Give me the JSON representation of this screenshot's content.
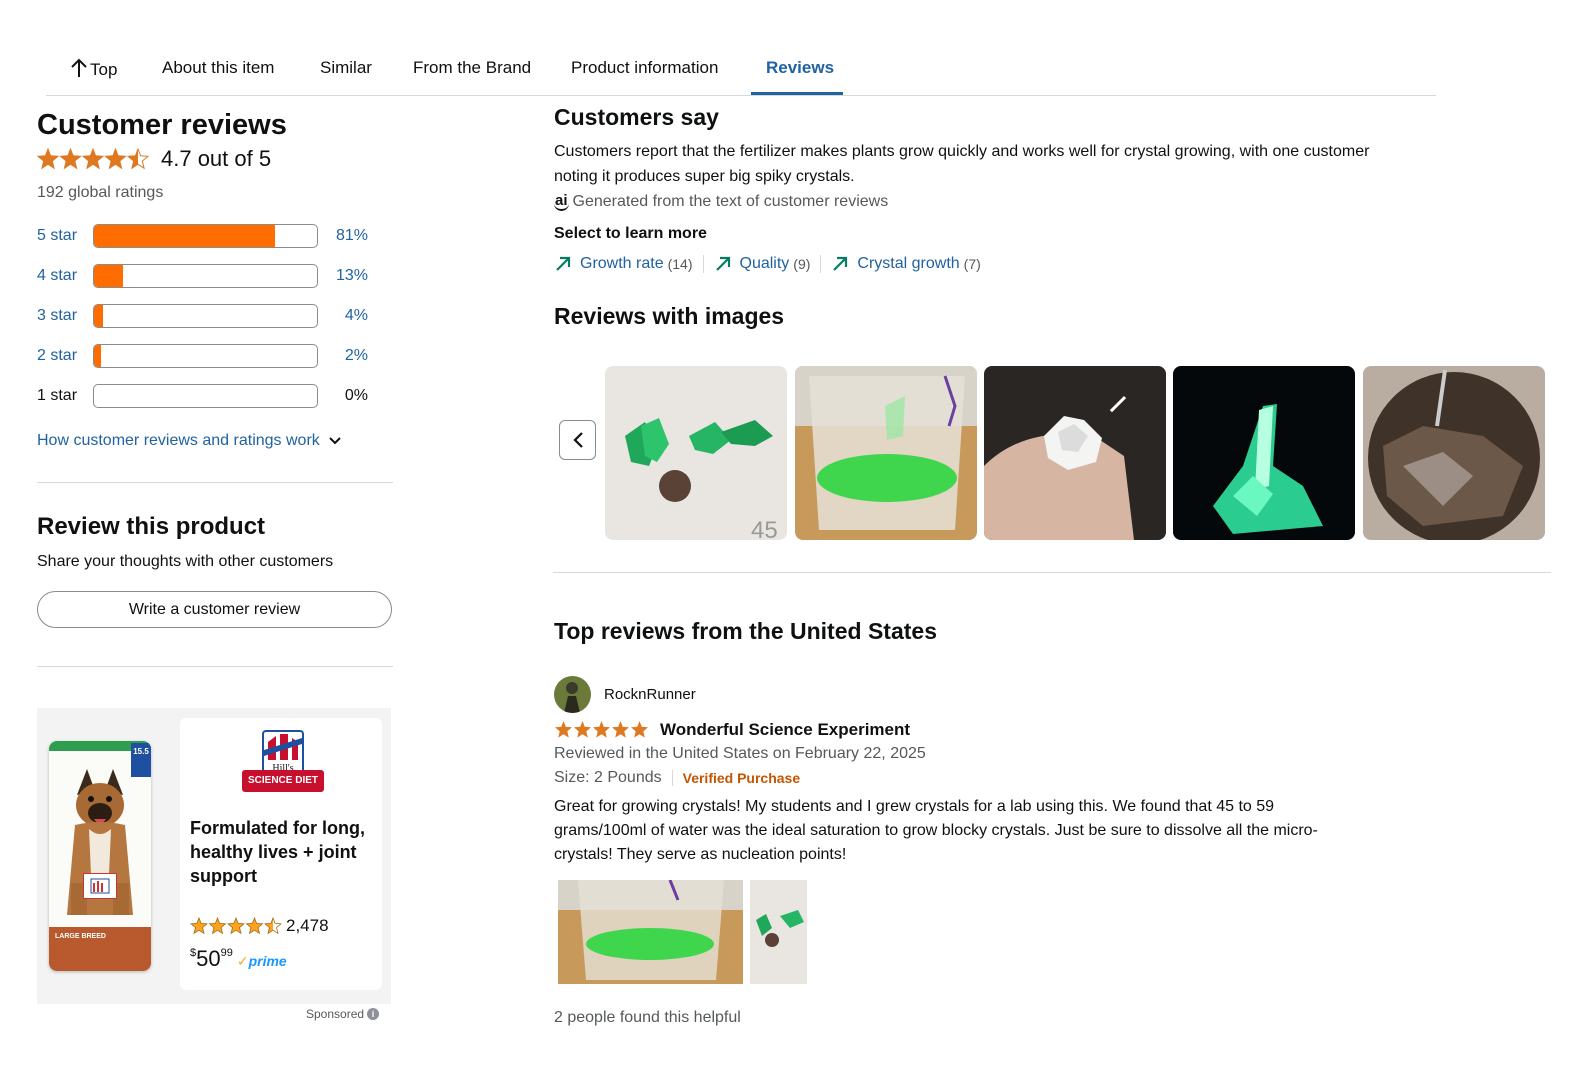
{
  "nav": {
    "items": [
      {
        "label": "Top",
        "name": "nav-top"
      },
      {
        "label": "About this item",
        "name": "nav-about"
      },
      {
        "label": "Similar",
        "name": "nav-similar"
      },
      {
        "label": "From the Brand",
        "name": "nav-brand"
      },
      {
        "label": "Product information",
        "name": "nav-product-info"
      },
      {
        "label": "Reviews",
        "name": "nav-reviews"
      }
    ],
    "active": "Reviews"
  },
  "summary": {
    "title": "Customer reviews",
    "rating": 4.7,
    "rating_text": "4.7 out of 5",
    "global_ratings": "192 global ratings",
    "histogram": [
      {
        "label": "5 star",
        "percent": 81,
        "percent_text": "81%"
      },
      {
        "label": "4 star",
        "percent": 13,
        "percent_text": "13%"
      },
      {
        "label": "3 star",
        "percent": 4,
        "percent_text": "4%"
      },
      {
        "label": "2 star",
        "percent": 2,
        "percent_text": "2%"
      },
      {
        "label": "1 star",
        "percent": 0,
        "percent_text": "0%"
      }
    ],
    "how_link": "How customer reviews and ratings work"
  },
  "review_product": {
    "title": "Review this product",
    "subtitle": "Share your thoughts with other customers",
    "button": "Write a customer review"
  },
  "ad": {
    "brand_logo_text": "Hill's",
    "brand_banner": "SCIENCE DIET",
    "headline": "Formulated for long, healthy lives + joint support",
    "rating": 4.5,
    "rating_count": "2,478",
    "price_symbol": "$",
    "price_whole": "50",
    "price_fraction": "99",
    "prime": "prime",
    "sponsored": "Sponsored",
    "bag_weight": "15.5",
    "bag_label": "LARGE BREED"
  },
  "customers_say": {
    "title": "Customers say",
    "summary": "Customers report that the fertilizer makes plants grow quickly and works well for crystal growing, with one customer noting it produces super big spiky crystals.",
    "ai_badge": "ai",
    "ai_note": "Generated from the text of customer reviews",
    "select_label": "Select to learn more",
    "aspects": [
      {
        "label": "Growth rate",
        "count": "(14)"
      },
      {
        "label": "Quality",
        "count": "(9)"
      },
      {
        "label": "Crystal growth",
        "count": "(7)"
      }
    ]
  },
  "images_section": {
    "title": "Reviews with images",
    "images": [
      "green-crystals-with-coin",
      "green-crystals-in-cup",
      "white-crystals-in-hand",
      "glowing-green-crystal",
      "brown-crystals-in-jar"
    ]
  },
  "top_reviews": {
    "title": "Top reviews from the United States",
    "review": {
      "author": "RocknRunner",
      "rating": 5,
      "title": "Wonderful Science Experiment",
      "date": "Reviewed in the United States on February 22, 2025",
      "size": "Size: 2 Pounds",
      "verified": "Verified Purchase",
      "body": "Great for growing crystals! My students and I grew crystals for a lab using this. We found that 45 to 59 grams/100ml of water was the ideal saturation to grow blocky crystals. Just be sure to dissolve all the micro-crystals! They serve as nucleation points!",
      "helpful": "2 people found this helpful"
    }
  },
  "colors": {
    "star": "#de7921",
    "bar_fill": "#ff6c00",
    "link": "#2162a1",
    "verified": "#c45500",
    "prime": "#1a98ff"
  }
}
